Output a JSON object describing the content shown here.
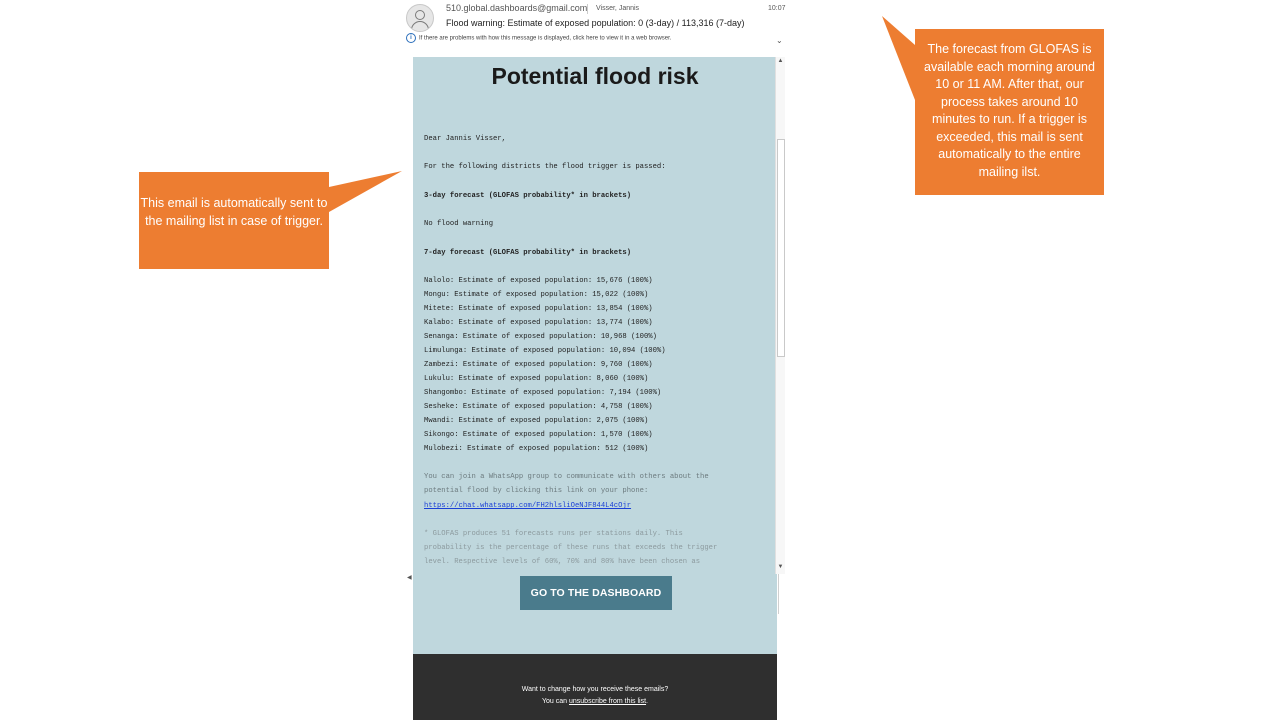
{
  "mail": {
    "from": "510.global.dashboards@gmail.com",
    "to": "Visser, Jannis",
    "time": "10:07",
    "subject": "Flood warning: Estimate of exposed population: 0 (3-day) / 113,316 (7-day)",
    "info_bar": "If there are problems with how this message is displayed, click here to view it in a web browser."
  },
  "email": {
    "title": "Potential flood risk",
    "greeting": "Dear Jannis Visser,",
    "intro": "For the following districts the flood trigger is passed:",
    "forecast3_heading": "3-day forecast (GLOFAS probability* in brackets)",
    "forecast3_none": "No flood warning",
    "forecast7_heading": "7-day forecast (GLOFAS probability* in brackets)",
    "districts": [
      "Nalolo: Estimate of exposed population: 15,676 (100%)",
      "Mongu: Estimate of exposed population: 15,022 (100%)",
      "Mitete: Estimate of exposed population: 13,854 (100%)",
      "Kalabo: Estimate of exposed population: 13,774 (100%)",
      "Senanga: Estimate of exposed population: 10,968 (100%)",
      "Limulunga: Estimate of exposed population: 10,094 (100%)",
      "Zambezi: Estimate of exposed population: 9,760 (100%)",
      "Lukulu: Estimate of exposed population: 8,060 (100%)",
      "Shangombo: Estimate of exposed population: 7,194 (100%)",
      "Sesheke: Estimate of exposed population: 4,758 (100%)",
      "Mwandi: Estimate of exposed population: 2,075 (100%)",
      "Sikongo: Estimate of exposed population: 1,570 (100%)",
      "Mulobezi: Estimate of exposed population: 512 (100%)"
    ],
    "whatsapp_line1": "You can join a WhatsApp group to communicate with others about the",
    "whatsapp_line2": "potential flood by clicking this link on your phone:",
    "whatsapp_link": "https://chat.whatsapp.com/FH2hlsliOeNJF844L4cOjr",
    "footnote_line1": "* GLOFAS produces 51 forecasts runs per stations daily. This",
    "footnote_line2": "probability is the percentage of these runs that exceeds the trigger",
    "footnote_line3": "level. Respective levels of 60%, 70% and 80% have been chosen as",
    "dashboard_button": "GO TO THE DASHBOARD",
    "footer_line1": "Want to change how you receive these emails?",
    "footer_line2_prefix": "You can ",
    "footer_link": "unsubscribe from this list",
    "footer_line2_suffix": "."
  },
  "callouts": {
    "left": "This email is automatically sent to the mailing list in case of trigger.",
    "right": "The forecast from GLOFAS is available each morning around 10 or 11 AM. After that, our process takes around 10 minutes to run. If a trigger is exceeded, this mail is sent automatically to the entire mailing ilst."
  },
  "colors": {
    "callout": "#ed7d31",
    "email_background": "#bfd7dd",
    "button": "#4a7b8c",
    "footer": "#2f2f2f"
  }
}
